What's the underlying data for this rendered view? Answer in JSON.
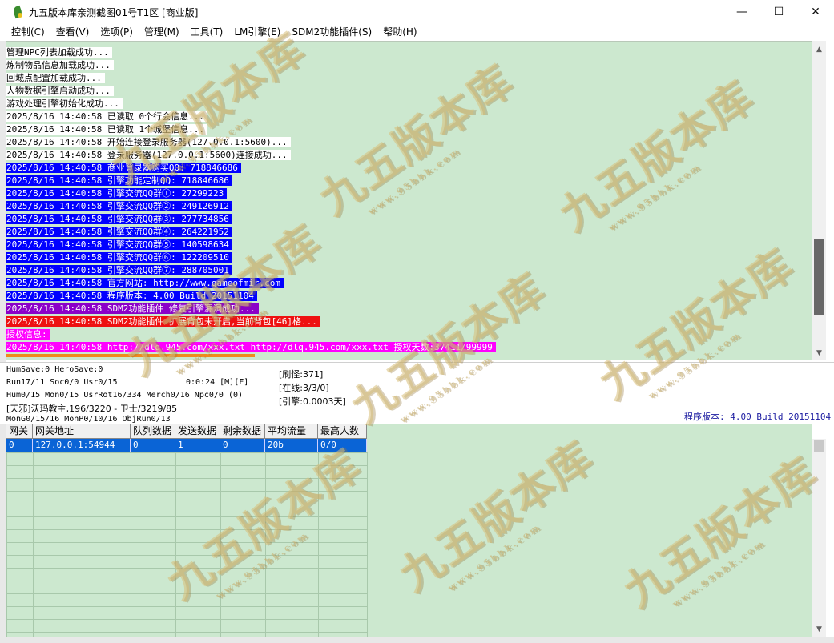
{
  "window": {
    "title": "九五版本库亲测截图01号T1区 [商业版]",
    "minimize": "—",
    "maximize": "☐",
    "close": "✕"
  },
  "menu": [
    "控制(C)",
    "查看(V)",
    "选项(P)",
    "管理(M)",
    "工具(T)",
    "LM引擎(E)",
    "SDM2功能插件(S)",
    "帮助(H)"
  ],
  "log": [
    {
      "style": "lw",
      "text": "管理NPC列表加载成功..."
    },
    {
      "style": "lw",
      "text": "炼制物品信息加载成功..."
    },
    {
      "style": "lw",
      "text": "回城点配置加载成功..."
    },
    {
      "style": "lw",
      "text": "人物数据引擎启动成功..."
    },
    {
      "style": "lw",
      "text": "游戏处理引擎初始化成功..."
    },
    {
      "style": "lw",
      "text": "2025/8/16 14:40:58 已读取 0个行会信息..."
    },
    {
      "style": "lw",
      "text": "2025/8/16 14:40:58 已读取 1个城堡信息..."
    },
    {
      "style": "lw",
      "text": "2025/8/16 14:40:58 开始连接登录服务器(127.0.0.1:5600)..."
    },
    {
      "style": "lw",
      "text": "2025/8/16 14:40:58 登录服务器(127.0.0.1:5600)连接成功..."
    },
    {
      "style": "lb",
      "text": "2025/8/16 14:40:58 商业登录器购买QQ: 718846686"
    },
    {
      "style": "lb",
      "text": "2025/8/16 14:40:58 引擎功能定制QQ: 718846686"
    },
    {
      "style": "lb",
      "text": "2025/8/16 14:40:58 引擎交流QQ群①: 27299223"
    },
    {
      "style": "lb",
      "text": "2025/8/16 14:40:58 引擎交流QQ群②: 249126912"
    },
    {
      "style": "lb",
      "text": "2025/8/16 14:40:58 引擎交流QQ群③: 277734856"
    },
    {
      "style": "lb",
      "text": "2025/8/16 14:40:58 引擎交流QQ群④: 264221952"
    },
    {
      "style": "lb",
      "text": "2025/8/16 14:40:58 引擎交流QQ群⑤: 140598634"
    },
    {
      "style": "lb",
      "text": "2025/8/16 14:40:58 引擎交流QQ群⑥: 122209510"
    },
    {
      "style": "lb",
      "text": "2025/8/16 14:40:58 引擎交流QQ群⑦: 288705001"
    },
    {
      "style": "lb",
      "text": "2025/8/16 14:40:58 官方网站: http://www.gameofmir.com"
    },
    {
      "style": "lb",
      "text": "2025/8/16 14:40:58 程序版本: 4.00 Build 20151104"
    },
    {
      "style": "lp",
      "text": "2025/8/16 14:40:58 SDM2功能插件 修复引擎漏洞成功..."
    },
    {
      "style": "lr",
      "text": "2025/8/16 14:40:58 SDM2功能插件 扩展背包未开启,当前背包[46]格..."
    },
    {
      "style": "lm",
      "text": "授权信息:"
    },
    {
      "style": "lm",
      "text": "2025/8/16 14:40:58 http://dlq.945.com/xxx.txt http://dlq.945.com/xxx.txt 授权天数:37411/99999"
    }
  ],
  "status": {
    "l1": "HumSave:0 HeroSave:0",
    "l2": "Run17/11 Soc0/0 Usr0/15",
    "l3": "Hum0/15 Mon0/15 UsrRot16/334 Merch0/16 Npc0/0 (0)",
    "l4": "[天邪]沃玛教主,196/3220 - 卫士/3219/85",
    "l5": "MonG0/15/16 MonP0/10/16 ObjRun0/13",
    "time": "0:0:24 [M][F]",
    "refresh": "[刷怪:371]",
    "online": "[在线:3/3/0]",
    "engine": "[引擎:0.0003天]",
    "version": "程序版本: 4.00 Build 20151104"
  },
  "grid": {
    "headers": [
      "网关",
      "网关地址",
      "队列数据",
      "发送数据",
      "剩余数据",
      "平均流量",
      "最高人数"
    ],
    "rows": [
      [
        "0",
        "127.0.0.1:54944",
        "0",
        "1",
        "0",
        "20b",
        "0/0"
      ]
    ]
  },
  "watermark": {
    "text": "九五版本库",
    "url": "www.95bbk.com"
  }
}
